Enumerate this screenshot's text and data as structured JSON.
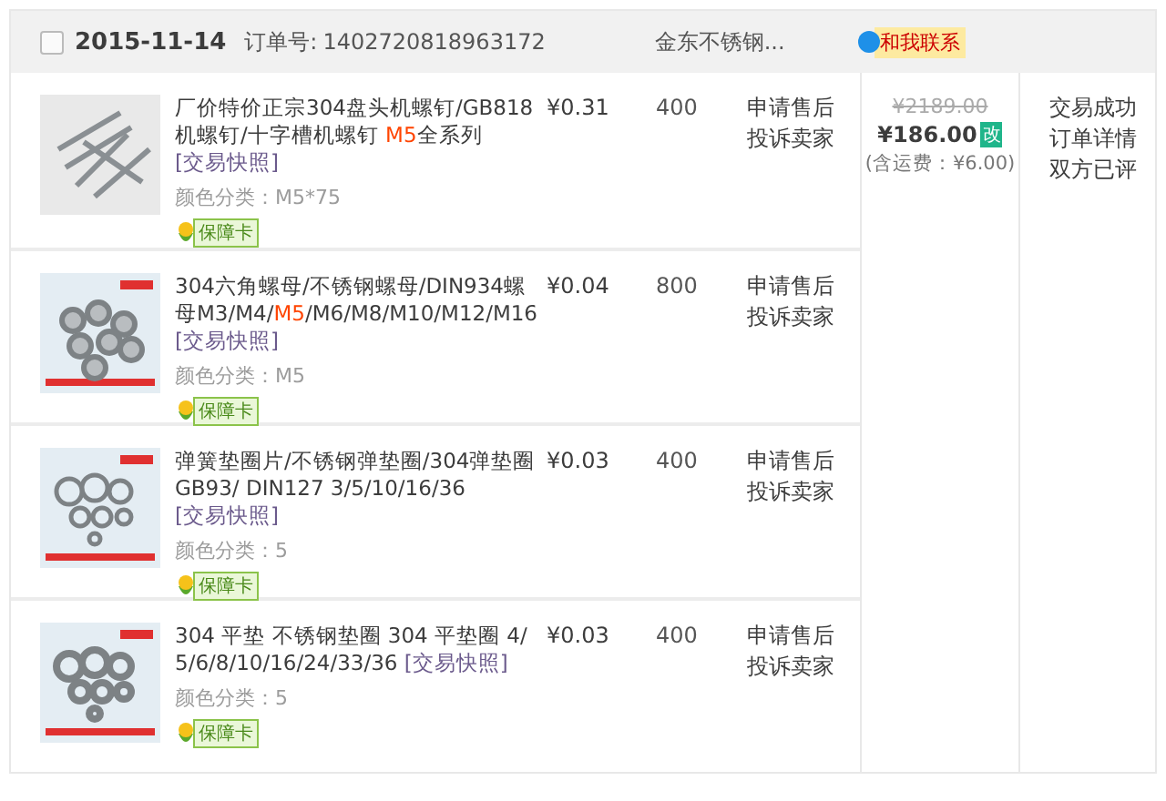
{
  "order": {
    "checked": false,
    "date": "2015-11-14",
    "number_label": "订单号:",
    "number": "1402720818963172",
    "shop": "金东不锈钢...",
    "contact": "和我联系"
  },
  "items": [
    {
      "title_parts": [
        {
          "text": "厂价特价正宗304盘头机螺钉/GB818机螺钉/十字槽机螺钉 ",
          "highlight": false
        },
        {
          "text": "M5",
          "highlight": true
        },
        {
          "text": "全系列 ",
          "highlight": false
        }
      ],
      "snapshot": "[交易快照]",
      "variant": "颜色分类：M5*75",
      "guarantee": "保障卡",
      "price": "¥0.31",
      "quantity": "400",
      "actions": [
        "申请售后",
        "投诉卖家"
      ]
    },
    {
      "title_parts": [
        {
          "text": "304六角螺母/不锈钢螺母/DIN934螺母M3/M4/",
          "highlight": false
        },
        {
          "text": "M5",
          "highlight": true
        },
        {
          "text": "/M6/M8/M10/M12/M16 ",
          "highlight": false
        }
      ],
      "snapshot": "[交易快照]",
      "variant": "颜色分类：M5",
      "guarantee": "保障卡",
      "price": "¥0.04",
      "quantity": "800",
      "actions": [
        "申请售后",
        "投诉卖家"
      ]
    },
    {
      "title_parts": [
        {
          "text": "弹簧垫圈片/不锈钢弹垫圈/304弹垫圈GB93/ DIN127 3/5/10/16/36 ",
          "highlight": false
        }
      ],
      "snapshot": "[交易快照]",
      "variant": "颜色分类：5",
      "guarantee": "保障卡",
      "price": "¥0.03",
      "quantity": "400",
      "actions": [
        "申请售后",
        "投诉卖家"
      ]
    },
    {
      "title_parts": [
        {
          "text": "304 平垫 不锈钢垫圈 304 平垫圈 4/5/6/8/10/16/24/33/36 ",
          "highlight": false
        }
      ],
      "snapshot": "[交易快照]",
      "variant": "颜色分类：5",
      "guarantee": "保障卡",
      "price": "¥0.03",
      "quantity": "400",
      "actions": [
        "申请售后",
        "投诉卖家"
      ]
    }
  ],
  "total": {
    "original": "¥2189.00",
    "amount": "¥186.00",
    "edit_tag": "改",
    "shipping": "(含运费：¥6.00)"
  },
  "status": [
    "交易成功",
    "订单详情",
    "双方已评"
  ]
}
